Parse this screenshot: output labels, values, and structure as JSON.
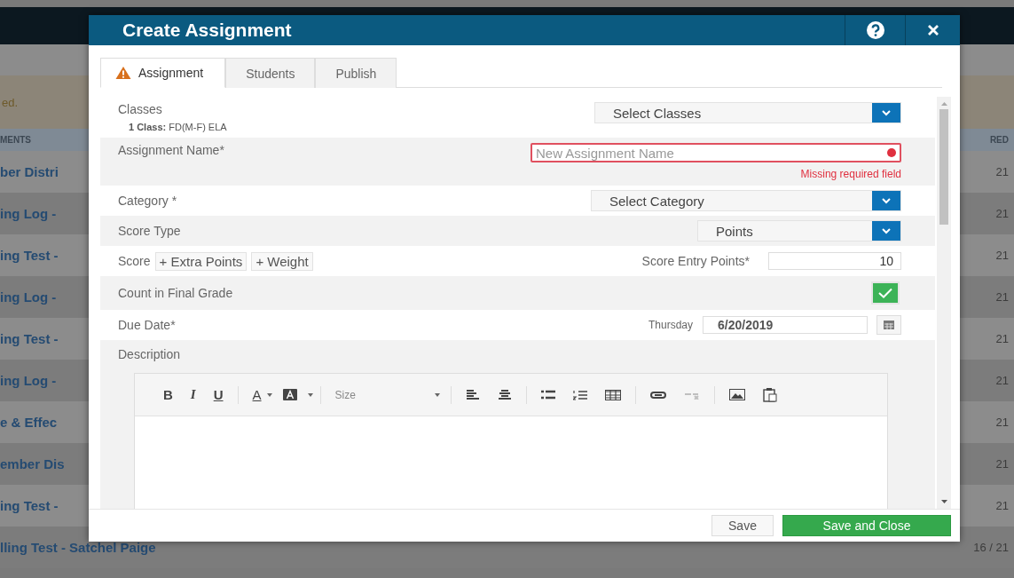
{
  "background": {
    "notice": "ed.",
    "left_header": "MENTS",
    "right_header": "RED",
    "rows": [
      {
        "title": "ber Distri",
        "score": "21"
      },
      {
        "title": "ing Log -",
        "score": "21"
      },
      {
        "title": "ing Test -",
        "score": "21"
      },
      {
        "title": "ing Log -",
        "score": "21"
      },
      {
        "title": "ing Test -",
        "score": "21"
      },
      {
        "title": "ing Log -",
        "score": "21"
      },
      {
        "title": "e & Effec",
        "score": "21"
      },
      {
        "title": "ember Dis",
        "score": "21"
      },
      {
        "title": "ing Test -",
        "score": "21"
      },
      {
        "title": "lling Test - Satchel Paige",
        "score": "16 / 21"
      }
    ]
  },
  "dialog": {
    "title": "Create Assignment",
    "tabs": [
      {
        "label": "Assignment",
        "selected": true,
        "warning": true
      },
      {
        "label": "Students",
        "selected": false,
        "warning": false
      },
      {
        "label": "Publish",
        "selected": false,
        "warning": false
      }
    ],
    "classes": {
      "label": "Classes",
      "summary": "**1 Class:** FD(M-F) ELA",
      "select": "Select Classes"
    },
    "assignment_name": {
      "label": "Assignment Name*",
      "placeholder": "New Assignment Name",
      "error": "Missing required field"
    },
    "category": {
      "label": "Category *",
      "select": "Select Category"
    },
    "score_type": {
      "label": "Score Type",
      "select": "Points"
    },
    "score": {
      "label": "Score",
      "buttons": [
        "+ Extra Points",
        "+ Weight"
      ],
      "entry_label": "Score Entry Points*",
      "entry_value": "10"
    },
    "count_in_final_grade": {
      "label": "Count in Final Grade",
      "checked": true
    },
    "due_date": {
      "label": "Due Date*",
      "weekday": "Thursday",
      "value": "6/20/2019"
    },
    "description": {
      "label": "Description",
      "text_tools": [
        "B",
        "I",
        "U"
      ],
      "color_tools": [
        "A"
      ],
      "size": "Size",
      "tools": [
        {
          "disabled": false
        },
        {
          "disabled": false
        },
        {
          "disabled": false
        },
        {
          "disabled": false
        },
        {
          "disabled": false
        },
        {
          "disabled": false
        },
        {
          "disabled": true
        },
        {
          "disabled": false
        },
        {
          "disabled": false
        }
      ]
    },
    "footer": {
      "save": "Save",
      "save_close": "Save and Close"
    }
  }
}
